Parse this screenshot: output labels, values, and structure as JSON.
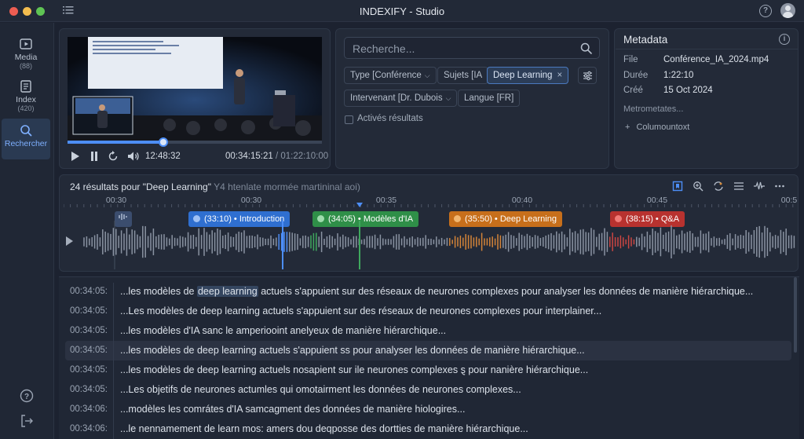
{
  "app": {
    "title": "INDEXIFY - Studio"
  },
  "sidebar": {
    "items": [
      {
        "label": "Media",
        "count": "(88)",
        "icon": "media-icon"
      },
      {
        "label": "Index",
        "count": "(420)",
        "icon": "index-icon"
      },
      {
        "label": "Rechercher",
        "count": "",
        "icon": "search-icon"
      }
    ],
    "bottom": [
      "help-icon",
      "logout-icon"
    ]
  },
  "player": {
    "progress": 0.377,
    "current_time": "12:48:32",
    "position": "00:34:15:21",
    "duration": "/ 01:22:10:00"
  },
  "search": {
    "placeholder": "Recherche...",
    "filters": {
      "type": "Type [Conférence",
      "sujets": "Sujets [IA",
      "selected": "Deep Learning",
      "intervenant": "Intervenant [Dr. Dubois",
      "langue": "Langue [FR]"
    },
    "checkbox_label": "Activés résultats"
  },
  "metadata": {
    "title": "Metadata",
    "fields": [
      {
        "key": "File",
        "value": "Conférence_IA_2024.mp4"
      },
      {
        "key": "Durée",
        "value": "1:22:10"
      },
      {
        "key": "Créé",
        "value": "15 Oct 2024"
      }
    ],
    "more": "Metrometates...",
    "add": "Columountoxt"
  },
  "timeline": {
    "results_title": "24 résultats pour \"Deep Learning\"",
    "results_sub": "Y4 htenlate mormée martininal aoi)",
    "ticks": [
      "00:30",
      "00:30",
      "00:35",
      "00:40",
      "00:45",
      "00:5"
    ],
    "markers": [
      {
        "label": "(33:10) • Introduction",
        "color": "#2f6fd0"
      },
      {
        "label": "(34:05) • Modèles d'IA",
        "color": "#2f8f48"
      },
      {
        "label": "(35:50) • Deep Learning",
        "color": "#c76f1b"
      },
      {
        "label": "(38:15) • Q&A",
        "color": "#b8322f"
      }
    ]
  },
  "transcript": {
    "rows": [
      {
        "time": "00:34:05:",
        "pre": "...les modèles de ",
        "kw": "deep learning",
        "post": " actuels s'appuient sur des réseaux de neurones complexes pour analyser les données de manière hiérarchique..."
      },
      {
        "time": "00:34:05:",
        "pre": "...Les modèles de deep learning actuels s'appuient sur des réseaux de neurones complexes pour interplainer...",
        "kw": "",
        "post": ""
      },
      {
        "time": "00:34:05:",
        "pre": "...les modèles d'IA sanc le amperiooint anelyeux de manière hiérarchique...",
        "kw": "",
        "post": ""
      },
      {
        "time": "00:34:05:",
        "pre": "...les modèles de deep learning actuels s'appuient ss pour analyser les données de manière hiérarchique...",
        "kw": "",
        "post": ""
      },
      {
        "time": "00:34:05:",
        "pre": "...les modèles de deep learning actuels nosapient sur ile neurones complexes ȿ pour nanière hiérarchique...",
        "kw": "",
        "post": ""
      },
      {
        "time": "00:34:05:",
        "pre": "...Les objetifs de neurones actumles qui omotairment les données de neurones complexes...",
        "kw": "",
        "post": ""
      },
      {
        "time": "00:34:06:",
        "pre": "...modèles les comrátes d'IA samcagment des données de manière hiologires...",
        "kw": "",
        "post": ""
      },
      {
        "time": "00:34:06:",
        "pre": "...le nennamement de learn mos: amers dou deqposse des dortties de manière hiérarchique...",
        "kw": "",
        "post": ""
      }
    ]
  }
}
